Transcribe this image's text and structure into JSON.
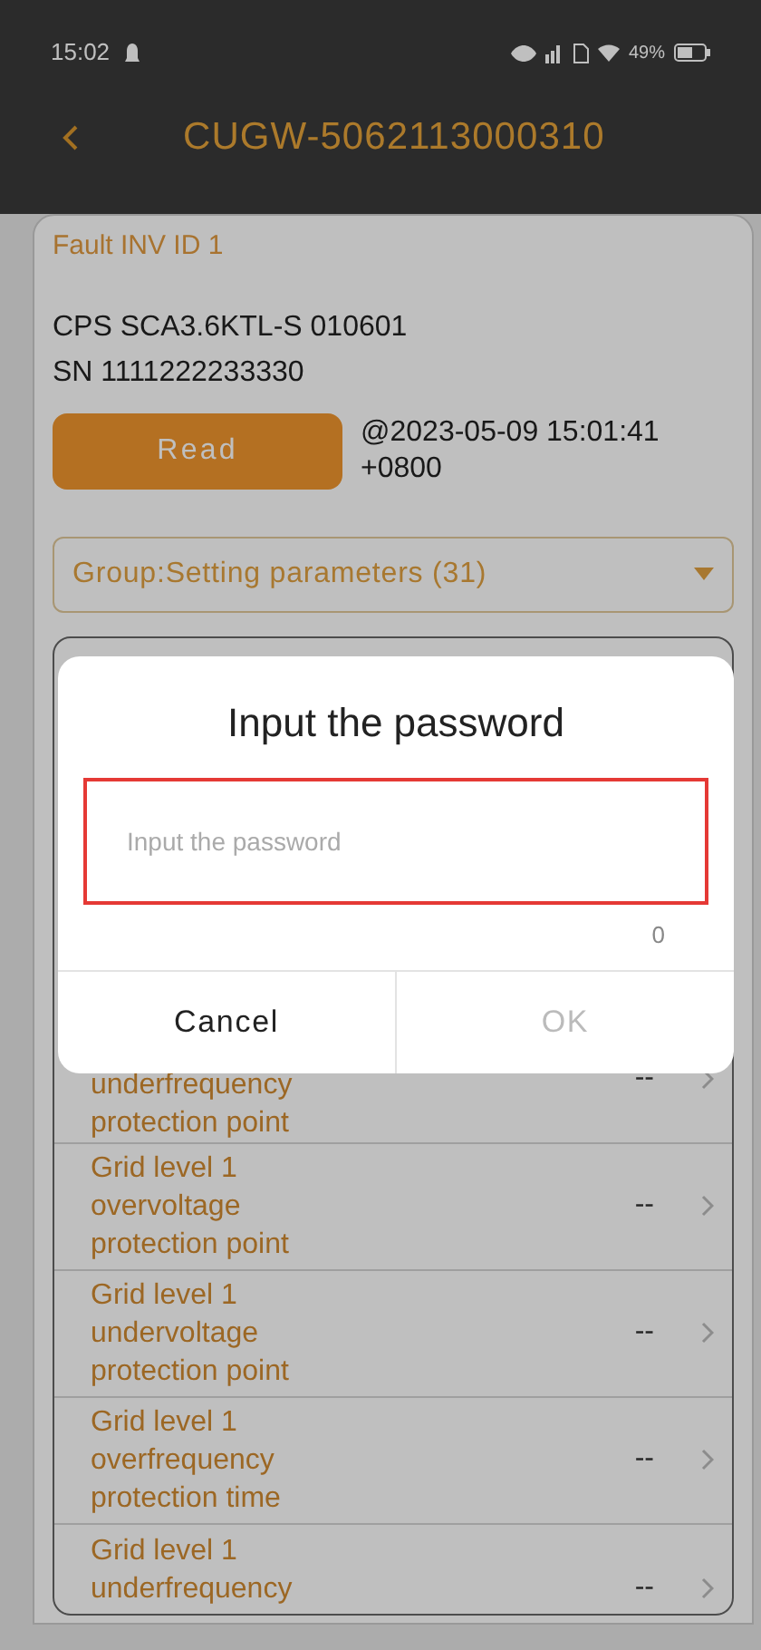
{
  "status_bar": {
    "time": "15:02",
    "battery": "49%"
  },
  "header": {
    "title": "CUGW-5062113000310"
  },
  "device": {
    "fault": "Fault INV ID 1",
    "model": "CPS SCA3.6KTL-S 010601",
    "sn": "SN 1111222233330",
    "read_button": "Read",
    "read_time": "@2023-05-09 15:01:41 +0800"
  },
  "group_select": {
    "value": "Group:Setting parameters (31)"
  },
  "parameters": [
    {
      "label": "underfrequency protection point",
      "value": "--"
    },
    {
      "label": "Grid level 1 overvoltage protection point",
      "value": "--"
    },
    {
      "label": "Grid level 1 undervoltage protection point",
      "value": "--"
    },
    {
      "label": "Grid level 1 overfrequency protection time",
      "value": "--"
    },
    {
      "label": "Grid level 1 underfrequency",
      "value": "--"
    }
  ],
  "dialog": {
    "title": "Input the password",
    "input": {
      "placeholder": "Input the password"
    },
    "counter": "0",
    "buttons": [
      {
        "label": "Cancel",
        "disabled": false
      },
      {
        "label": "OK",
        "disabled": true
      }
    ]
  }
}
